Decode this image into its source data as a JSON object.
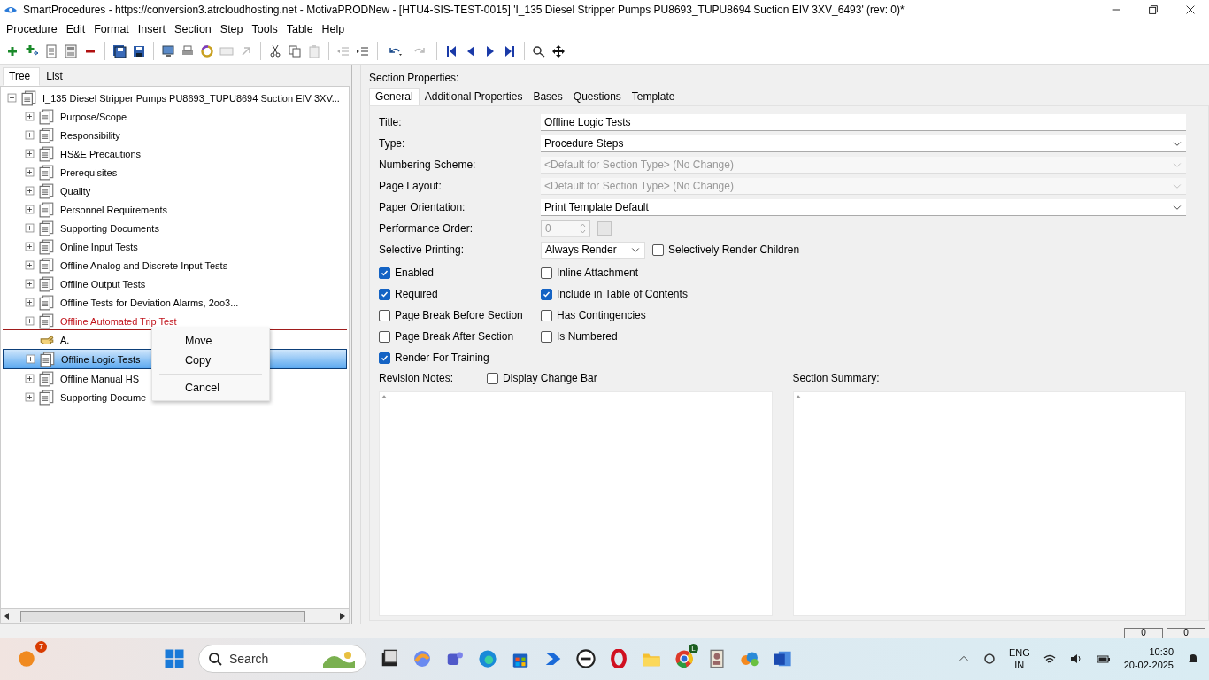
{
  "window": {
    "title": "SmartProcedures - https://conversion3.atrcloudhosting.net - MotivaPRODNew - [HTU4-SIS-TEST-0015] 'I_135 Diesel Stripper Pumps PU8693_TUPU8694 Suction EIV 3XV_6493' (rev: 0)*"
  },
  "menu": [
    {
      "label": "Procedure"
    },
    {
      "label": "Edit"
    },
    {
      "label": "Format"
    },
    {
      "label": "Insert"
    },
    {
      "label": "Section"
    },
    {
      "label": "Step"
    },
    {
      "label": "Tools"
    },
    {
      "label": "Table"
    },
    {
      "label": "Help"
    }
  ],
  "left_tabs": [
    {
      "label": "Tree",
      "selected": true
    },
    {
      "label": "List",
      "selected": false
    }
  ],
  "tree": {
    "label": "I_135 Diesel Stripper Pumps PU8693_TUPU8694 Suction EIV 3XV...",
    "expanded": true,
    "children": [
      {
        "kind": "section",
        "label": "Purpose/Scope",
        "selected": false,
        "drop_target": false
      },
      {
        "kind": "section",
        "label": "Responsibility",
        "selected": false,
        "drop_target": false
      },
      {
        "kind": "section",
        "label": "HS&E Precautions",
        "selected": false,
        "drop_target": false
      },
      {
        "kind": "section",
        "label": "Prerequisites",
        "selected": false,
        "drop_target": false
      },
      {
        "kind": "section",
        "label": "Quality",
        "selected": false,
        "drop_target": false
      },
      {
        "kind": "section",
        "label": "Personnel Requirements",
        "selected": false,
        "drop_target": false
      },
      {
        "kind": "section",
        "label": "Supporting Documents",
        "selected": false,
        "drop_target": false
      },
      {
        "kind": "section",
        "label": "Online Input Tests",
        "selected": false,
        "drop_target": false
      },
      {
        "kind": "section",
        "label": "Offline Analog and Discrete Input Tests",
        "selected": false,
        "drop_target": false
      },
      {
        "kind": "section",
        "label": "Offline Output Tests",
        "selected": false,
        "drop_target": false
      },
      {
        "kind": "section",
        "label": "Offline Tests for Deviation Alarms, 2oo3...",
        "selected": false,
        "drop_target": false
      },
      {
        "kind": "section",
        "label": "Offline Automated Trip Test",
        "selected": false,
        "drop_target": true
      },
      {
        "kind": "insert-point",
        "label": "A."
      },
      {
        "kind": "section",
        "label": "Offline Logic Tests",
        "selected": true,
        "drop_target": false
      },
      {
        "kind": "section",
        "label": "Offline Manual HS",
        "selected": false,
        "drop_target": false
      },
      {
        "kind": "section",
        "label": "Supporting Docume",
        "selected": false,
        "drop_target": false
      }
    ]
  },
  "context_menu": [
    {
      "kind": "item",
      "label": "Move"
    },
    {
      "kind": "item",
      "label": "Copy"
    },
    {
      "kind": "separator"
    },
    {
      "kind": "item",
      "label": "Cancel"
    }
  ],
  "properties": {
    "heading": "Section Properties:",
    "tabs": [
      {
        "label": "General",
        "selected": true
      },
      {
        "label": "Additional Properties",
        "selected": false
      },
      {
        "label": "Bases",
        "selected": false
      },
      {
        "label": "Questions",
        "selected": false
      },
      {
        "label": "Template",
        "selected": false
      }
    ],
    "fields": [
      {
        "kind": "text",
        "label": "Title:",
        "value": "Offline Logic Tests",
        "disabled": false
      },
      {
        "kind": "select",
        "label": "Type:",
        "value": "Procedure Steps",
        "disabled": false
      },
      {
        "kind": "select",
        "label": "Numbering Scheme:",
        "value": "<Default for Section Type> (No Change)",
        "disabled": true
      },
      {
        "kind": "select",
        "label": "Page Layout:",
        "value": "<Default for Section Type> (No Change)",
        "disabled": true
      },
      {
        "kind": "select",
        "label": "Paper Orientation:",
        "value": "Print Template Default",
        "disabled": false
      },
      {
        "kind": "spinner",
        "label": "Performance Order:",
        "value": "0",
        "disabled": true
      },
      {
        "kind": "select-check",
        "label": "Selective Printing:",
        "value": "Always Render",
        "disabled": false,
        "check": {
          "label": "Selectively Render Children",
          "checked": false
        }
      }
    ],
    "checkboxes": [
      {
        "label": "Enabled",
        "checked": true
      },
      {
        "label": "Inline Attachment",
        "checked": false
      },
      {
        "label": "Required",
        "checked": true
      },
      {
        "label": "Include in Table of Contents",
        "checked": true
      },
      {
        "label": "Page Break Before Section",
        "checked": false
      },
      {
        "label": "Has Contingencies",
        "checked": false
      },
      {
        "label": "Page Break After Section",
        "checked": false
      },
      {
        "label": "Is Numbered",
        "checked": false
      },
      {
        "label": "Render For Training",
        "checked": true
      }
    ],
    "revision_notes": {
      "label": "Revision Notes:",
      "change_bar": {
        "label": "Display Change Bar",
        "checked": false
      }
    },
    "section_summary": {
      "label": "Section Summary:"
    }
  },
  "status_bar": [
    "0",
    "0"
  ],
  "taskbar": {
    "weather_badge": "7",
    "search": {
      "placeholder": "Search"
    },
    "chrome_badge": "L",
    "language": [
      "ENG",
      "IN"
    ],
    "time": "10:30",
    "date": "20-02-2025"
  }
}
